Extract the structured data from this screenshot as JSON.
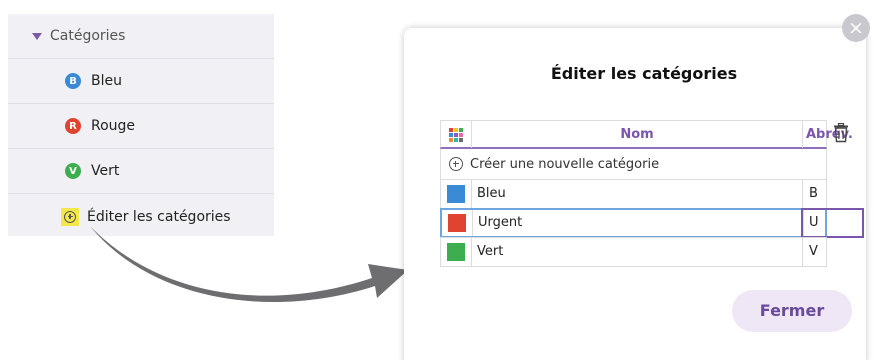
{
  "sidebar": {
    "header": "Catégories",
    "items": [
      {
        "letter": "B",
        "label": "Bleu",
        "color": "#3a8ad6"
      },
      {
        "letter": "R",
        "label": "Rouge",
        "color": "#e0432f"
      },
      {
        "letter": "V",
        "label": "Vert",
        "color": "#3cae4f"
      }
    ],
    "edit_label": "Éditer les catégories",
    "edit_icon_highlight": "#f5e64a"
  },
  "dialog": {
    "title": "Éditer les catégories",
    "close_icon": "×",
    "columns": {
      "name": "Nom",
      "abbr": "Abrév."
    },
    "create_label": "Créer une nouvelle catégorie",
    "rows": [
      {
        "name": "Bleu",
        "abbr": "B",
        "color": "#3a8ad6"
      },
      {
        "name": "Urgent",
        "abbr": "U",
        "color": "#e0432f"
      },
      {
        "name": "Vert",
        "abbr": "V",
        "color": "#3cae4f"
      }
    ],
    "close_button": "Fermer",
    "accent_color": "#7a56ad"
  }
}
